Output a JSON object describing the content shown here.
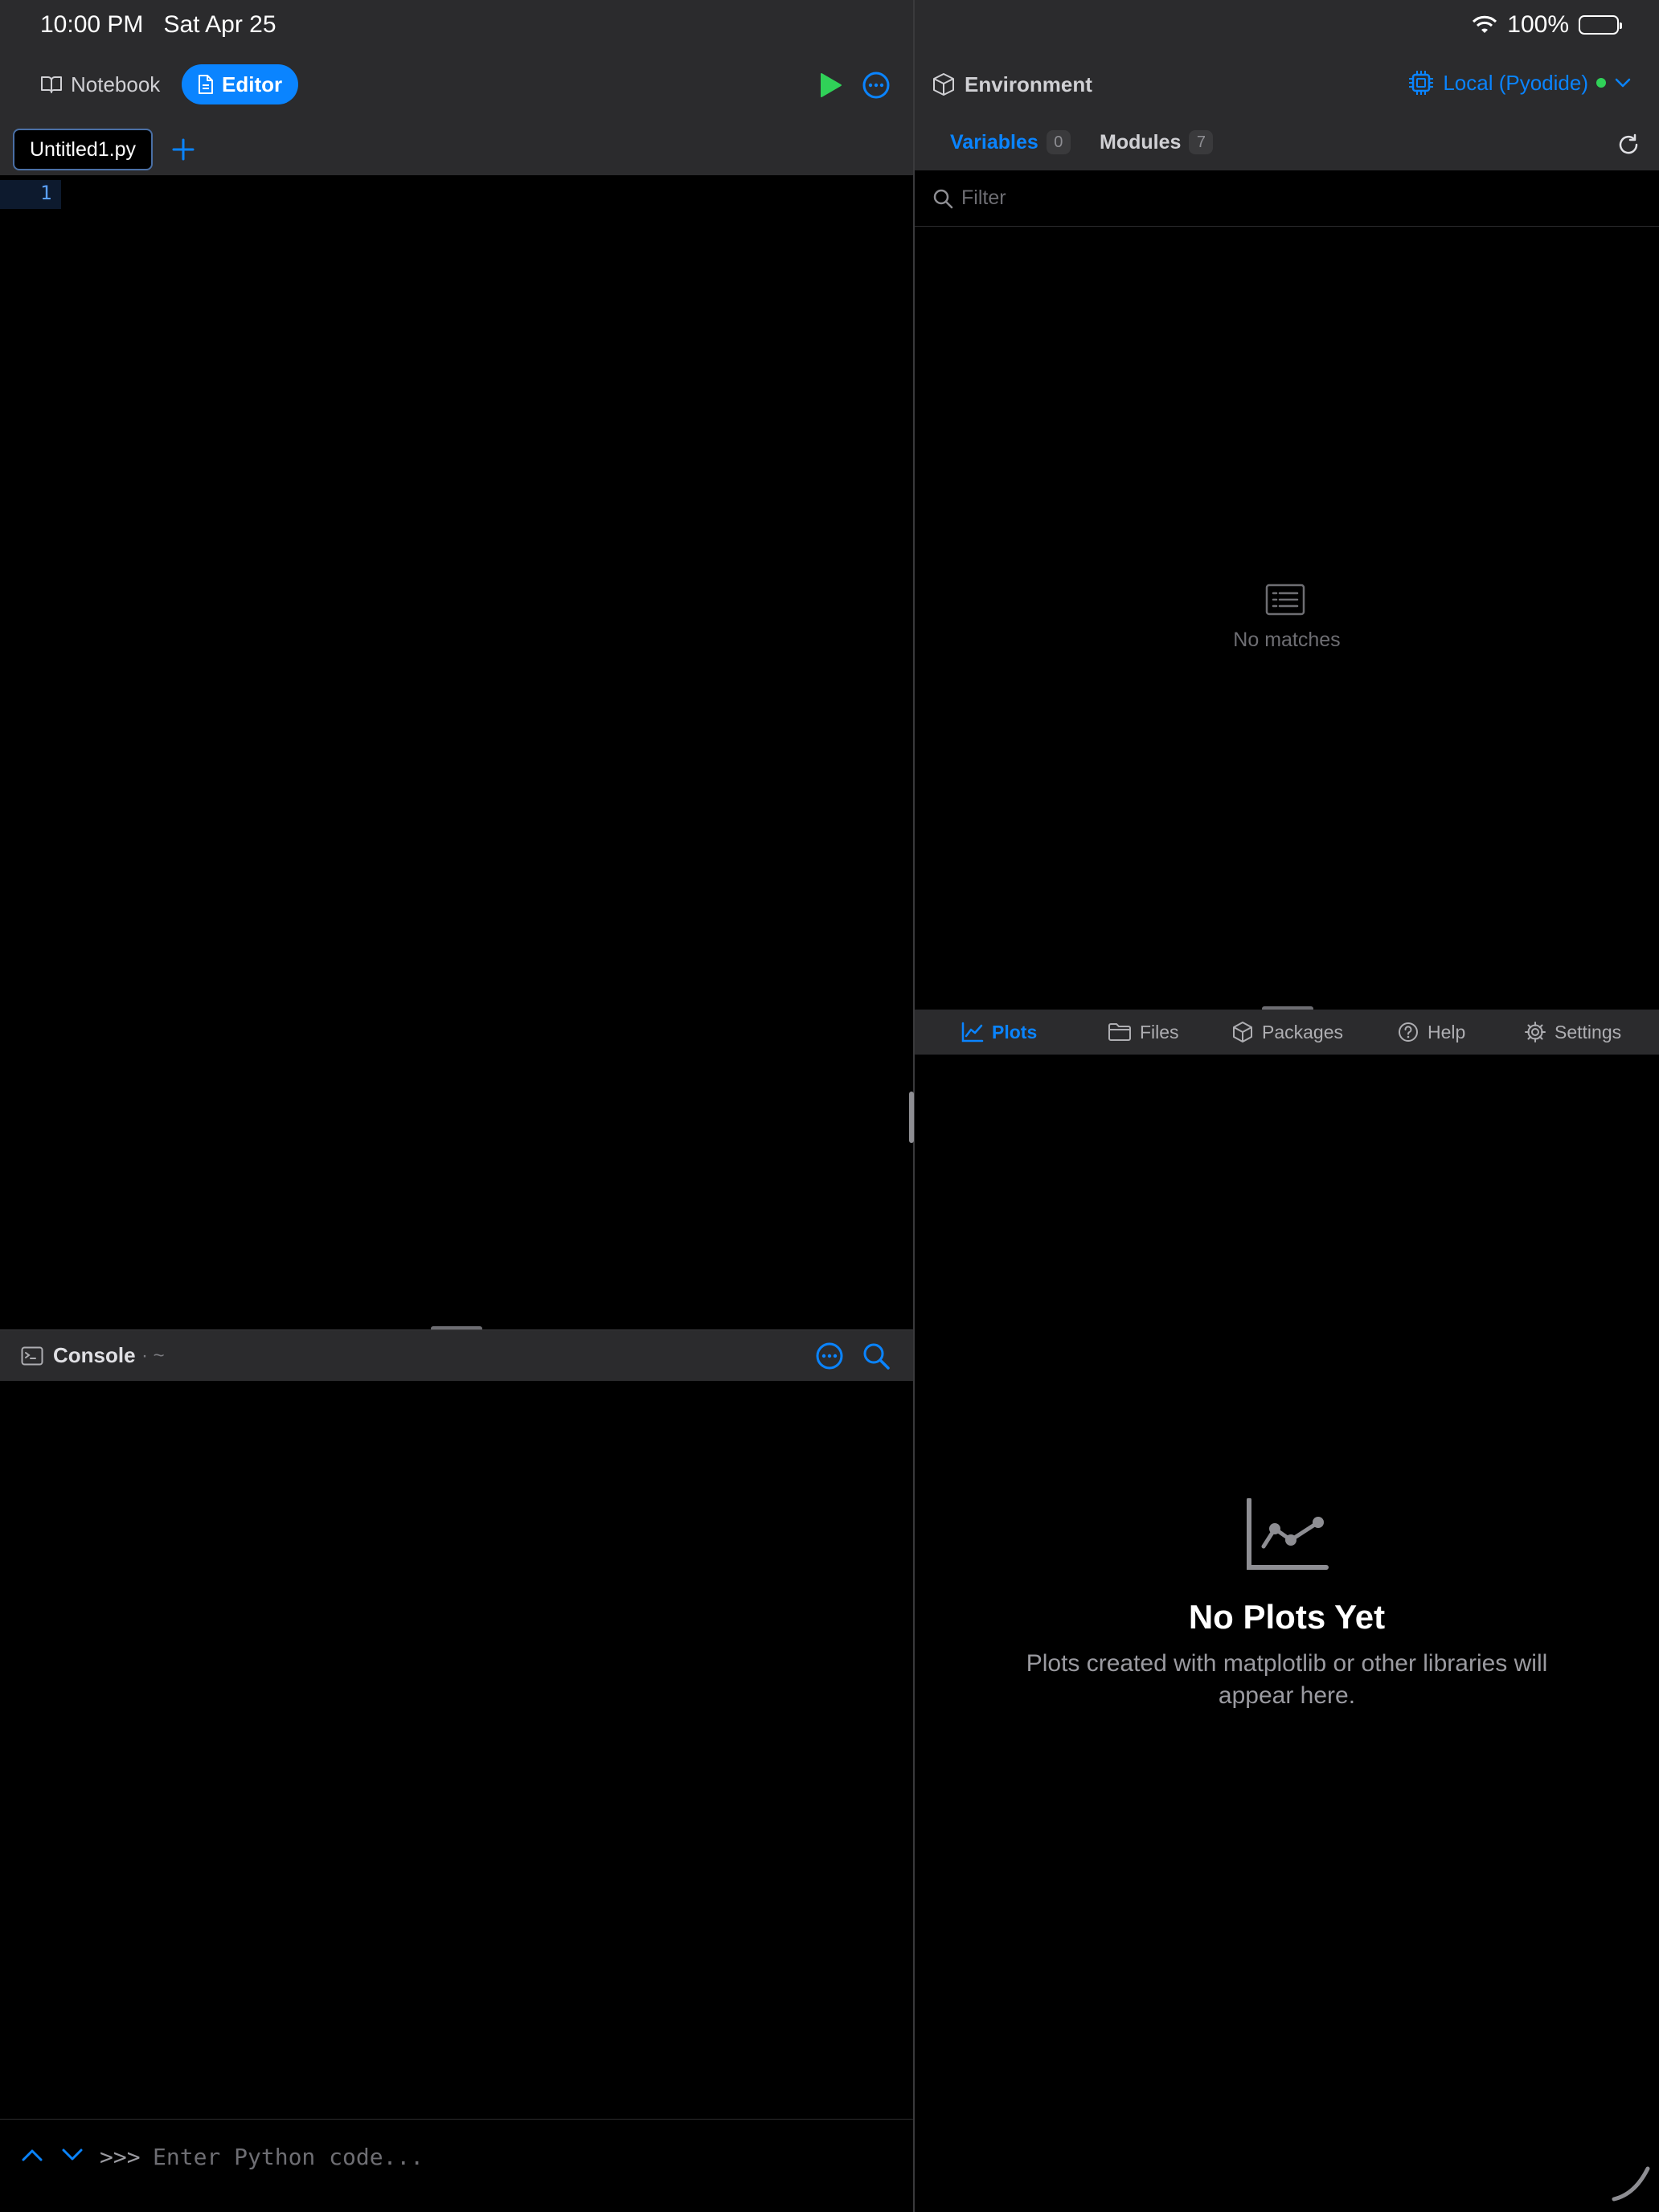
{
  "status_bar": {
    "time": "10:00 PM",
    "date": "Sat Apr 25",
    "battery": "100%"
  },
  "left_toolbar": {
    "notebook_label": "Notebook",
    "editor_label": "Editor"
  },
  "editor": {
    "tabs": [
      {
        "label": "Untitled1.py"
      }
    ],
    "line_numbers": [
      "1"
    ]
  },
  "console": {
    "title": "Console",
    "path": "· ~",
    "prompt": ">>>",
    "input_placeholder": "Enter Python code..."
  },
  "environment": {
    "title": "Environment",
    "kernel_label": "Local (Pyodide)",
    "tabs": [
      {
        "label": "Variables",
        "count": "0"
      },
      {
        "label": "Modules",
        "count": "7"
      }
    ],
    "filter_placeholder": "Filter",
    "empty_text": "No matches"
  },
  "bottom_tabs": [
    {
      "label": "Plots"
    },
    {
      "label": "Files"
    },
    {
      "label": "Packages"
    },
    {
      "label": "Help"
    },
    {
      "label": "Settings"
    }
  ],
  "plots": {
    "empty_title": "No Plots Yet",
    "empty_subtitle": "Plots created with matplotlib or other libraries will appear here."
  },
  "colors": {
    "accent": "#0a84ff",
    "run": "#30d158",
    "status_dot": "#30d158",
    "toolbar_bg": "#2b2b2d",
    "background": "#000000"
  }
}
